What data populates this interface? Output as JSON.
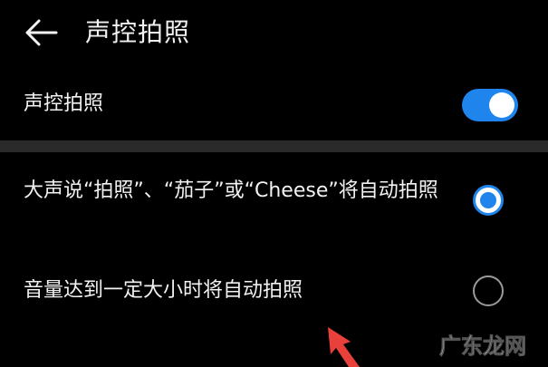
{
  "header": {
    "back_icon": "back-arrow-icon",
    "title": "声控拍照"
  },
  "settings": {
    "toggle_row": {
      "label": "声控拍照",
      "enabled": true
    }
  },
  "options": [
    {
      "label": "大声说“拍照”、“茄子”或“Cheese”将自动拍照",
      "selected": true
    },
    {
      "label": "音量达到一定大小时将自动拍照",
      "selected": false
    }
  ],
  "annotations": {
    "arrow_icon": "red-arrow-icon",
    "watermark_text": "广东龙网"
  },
  "colors": {
    "background": "#000000",
    "accent": "#1f84ec",
    "annotation_red": "#e8403a"
  }
}
